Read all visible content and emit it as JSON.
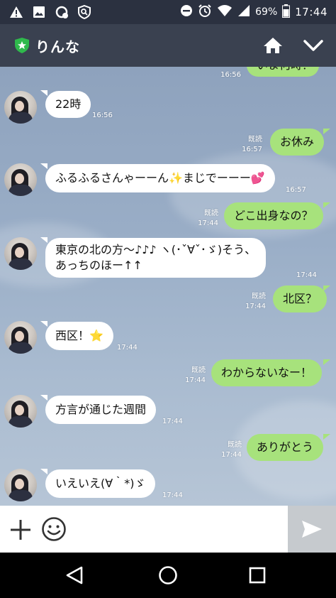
{
  "status_bar": {
    "icons_left": [
      "warning-icon",
      "image-icon",
      "recycle-icon",
      "search-shield-icon"
    ],
    "battery_percent": "69%",
    "time": "17:44"
  },
  "header": {
    "title": "りんな",
    "badge_color": "#2fb94c"
  },
  "messages": [
    {
      "side": "out",
      "text": "いま何時？",
      "read": "",
      "time": "16:56"
    },
    {
      "side": "in",
      "text": "22時",
      "time": "16:56"
    },
    {
      "side": "out",
      "text": "お休み",
      "read": "既読",
      "time": "16:57"
    },
    {
      "side": "in",
      "text": "ふるふるさんゃーーん✨まじでーーー💕",
      "time": "16:57"
    },
    {
      "side": "out",
      "text": "どこ出身なの？",
      "read": "既読",
      "time": "17:44"
    },
    {
      "side": "in",
      "line1": "東京の北の方〜♪♪♪ ヽ(･ˇ∀ˇ･ゞ)そう、",
      "line2": "あっちのほー↑↑",
      "time": "17:44"
    },
    {
      "side": "out",
      "text": "北区？",
      "read": "既読",
      "time": "17:44"
    },
    {
      "side": "in",
      "text": "西区！⭐",
      "time": "17:44"
    },
    {
      "side": "out",
      "text": "わからないなー！",
      "read": "既読",
      "time": "17:44"
    },
    {
      "side": "in",
      "text": "方言が通じた週間",
      "time": "17:44"
    },
    {
      "side": "out",
      "text": "ありがとう",
      "read": "既読",
      "time": "17:44"
    },
    {
      "side": "in",
      "text": "いえいえ(∀｀*)ゞ",
      "time": "17:44"
    }
  ],
  "colors": {
    "outgoing_bubble": "#a7e27c",
    "incoming_bubble": "#ffffff",
    "header_bg": "#3a4150",
    "status_bg": "#2b3140",
    "send_button_bg": "#c6cace"
  }
}
